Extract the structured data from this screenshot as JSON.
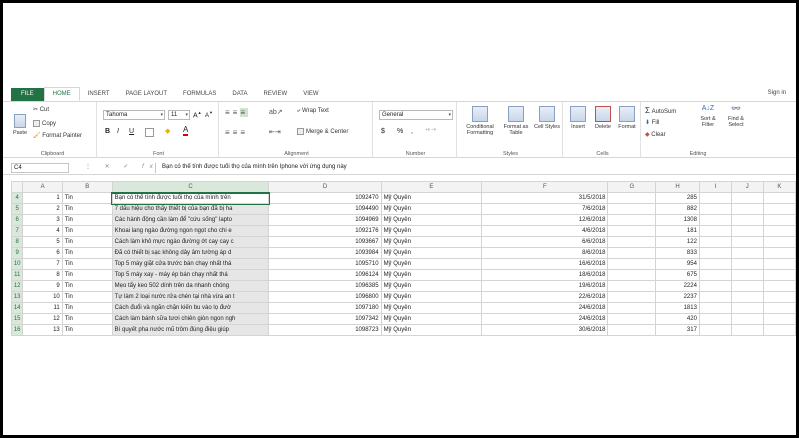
{
  "tabs": [
    "FILE",
    "HOME",
    "INSERT",
    "PAGE LAYOUT",
    "FORMULAS",
    "DATA",
    "REVIEW",
    "VIEW"
  ],
  "active_tab": "HOME",
  "sign_in": "Sign in",
  "clipboard": {
    "cut": "Cut",
    "copy": "Copy",
    "paste": "Paste",
    "format_painter": "Format Painter",
    "label": "Clipboard"
  },
  "font": {
    "name": "Tahoma",
    "size": "11",
    "label": "Font",
    "bold": "B",
    "italic": "I",
    "underline": "U"
  },
  "alignment": {
    "wrap": "Wrap Text",
    "merge": "Merge & Center",
    "label": "Alignment"
  },
  "number": {
    "format": "General",
    "currency": "$",
    "percent": "%",
    "comma": ",",
    "label": "Number"
  },
  "styles": {
    "conditional": "Conditional Formatting",
    "format_table": "Format as Table",
    "cell_styles": "Cell Styles",
    "label": "Styles"
  },
  "cells": {
    "insert": "Insert",
    "delete": "Delete",
    "format": "Format",
    "label": "Cells"
  },
  "editing": {
    "autosum": "AutoSum",
    "fill": "Fill",
    "clear": "Clear",
    "sort": "Sort & Filter",
    "find": "Find & Select",
    "label": "Editing"
  },
  "name_box": "C4",
  "formula": "Bạn có thể tính được tuổi thọ của mình trên Iphone với ứng dụng này",
  "columns": [
    "A",
    "B",
    "C",
    "D",
    "E",
    "F",
    "G",
    "H",
    "I",
    "J",
    "K"
  ],
  "rows": [
    {
      "row": "4",
      "a": "1",
      "b": "Tin",
      "c": "Bạn có thể tính được tuổi thọ của mình trên",
      "d": "1092470",
      "e": "Mỹ Quyên",
      "f": "31/5/2018",
      "h": "285"
    },
    {
      "row": "5",
      "a": "2",
      "b": "Tin",
      "c": "7 dấu hiệu cho thấy thiết bị của bạn đã bị ha",
      "d": "1094490",
      "e": "Mỹ Quyên",
      "f": "7/6/2018",
      "h": "882"
    },
    {
      "row": "6",
      "a": "3",
      "b": "Tin",
      "c": "Các hành động cần làm để \"cứu sống\" lapto",
      "d": "1094969",
      "e": "Mỹ Quyên",
      "f": "12/6/2018",
      "h": "1308"
    },
    {
      "row": "7",
      "a": "4",
      "b": "Tin",
      "c": "Khoai lang ngào đường ngon ngọt cho chi e",
      "d": "1092176",
      "e": "Mỹ Quyên",
      "f": "4/6/2018",
      "h": "181"
    },
    {
      "row": "8",
      "a": "5",
      "b": "Tin",
      "c": "Cách làm khô mực ngào đường ớt cay cay c",
      "d": "1093667",
      "e": "Mỹ Quyên",
      "f": "6/6/2018",
      "h": "122"
    },
    {
      "row": "9",
      "a": "6",
      "b": "Tin",
      "c": "Đã có thiết bị sạc không dây âm tường áp d",
      "d": "1093984",
      "e": "Mỹ Quyên",
      "f": "8/6/2018",
      "h": "833"
    },
    {
      "row": "10",
      "a": "7",
      "b": "Tin",
      "c": "Top 5 máy giặt cửa trước bán chạy nhất thá",
      "d": "1095710",
      "e": "Mỹ Quyên",
      "f": "16/6/2018",
      "h": "954"
    },
    {
      "row": "11",
      "a": "8",
      "b": "Tin",
      "c": "Top 5 máy xay - máy ép bán chạy nhất thá",
      "d": "1096124",
      "e": "Mỹ Quyên",
      "f": "18/6/2018",
      "h": "675"
    },
    {
      "row": "12",
      "a": "9",
      "b": "Tin",
      "c": "Mẹo tẩy keo 502 dính trên da nhanh chóng",
      "d": "1096385",
      "e": "Mỹ Quyên",
      "f": "19/6/2018",
      "h": "2224"
    },
    {
      "row": "13",
      "a": "10",
      "b": "Tin",
      "c": "Tự làm 2 loại nước rửa chén tại nhà vừa an t",
      "d": "1096800",
      "e": "Mỹ Quyên",
      "f": "22/6/2018",
      "h": "2237"
    },
    {
      "row": "14",
      "a": "11",
      "b": "Tin",
      "c": "Cách đuổi và ngăn chặn kiến bu vào lọ đườ",
      "d": "1097180",
      "e": "Mỹ Quyên",
      "f": "24/6/2018",
      "h": "1813"
    },
    {
      "row": "15",
      "a": "12",
      "b": "Tin",
      "c": "Cách làm bánh sữa tươi chiên giòn ngon ngh",
      "d": "1097342",
      "e": "Mỹ Quyên",
      "f": "24/6/2018",
      "h": "420"
    },
    {
      "row": "16",
      "a": "13",
      "b": "Tin",
      "c": "Bí quyết pha nước mũ trôm đúng điệu giúp",
      "d": "1098723",
      "e": "Mỹ Quyên",
      "f": "30/6/2018",
      "h": "317"
    }
  ]
}
